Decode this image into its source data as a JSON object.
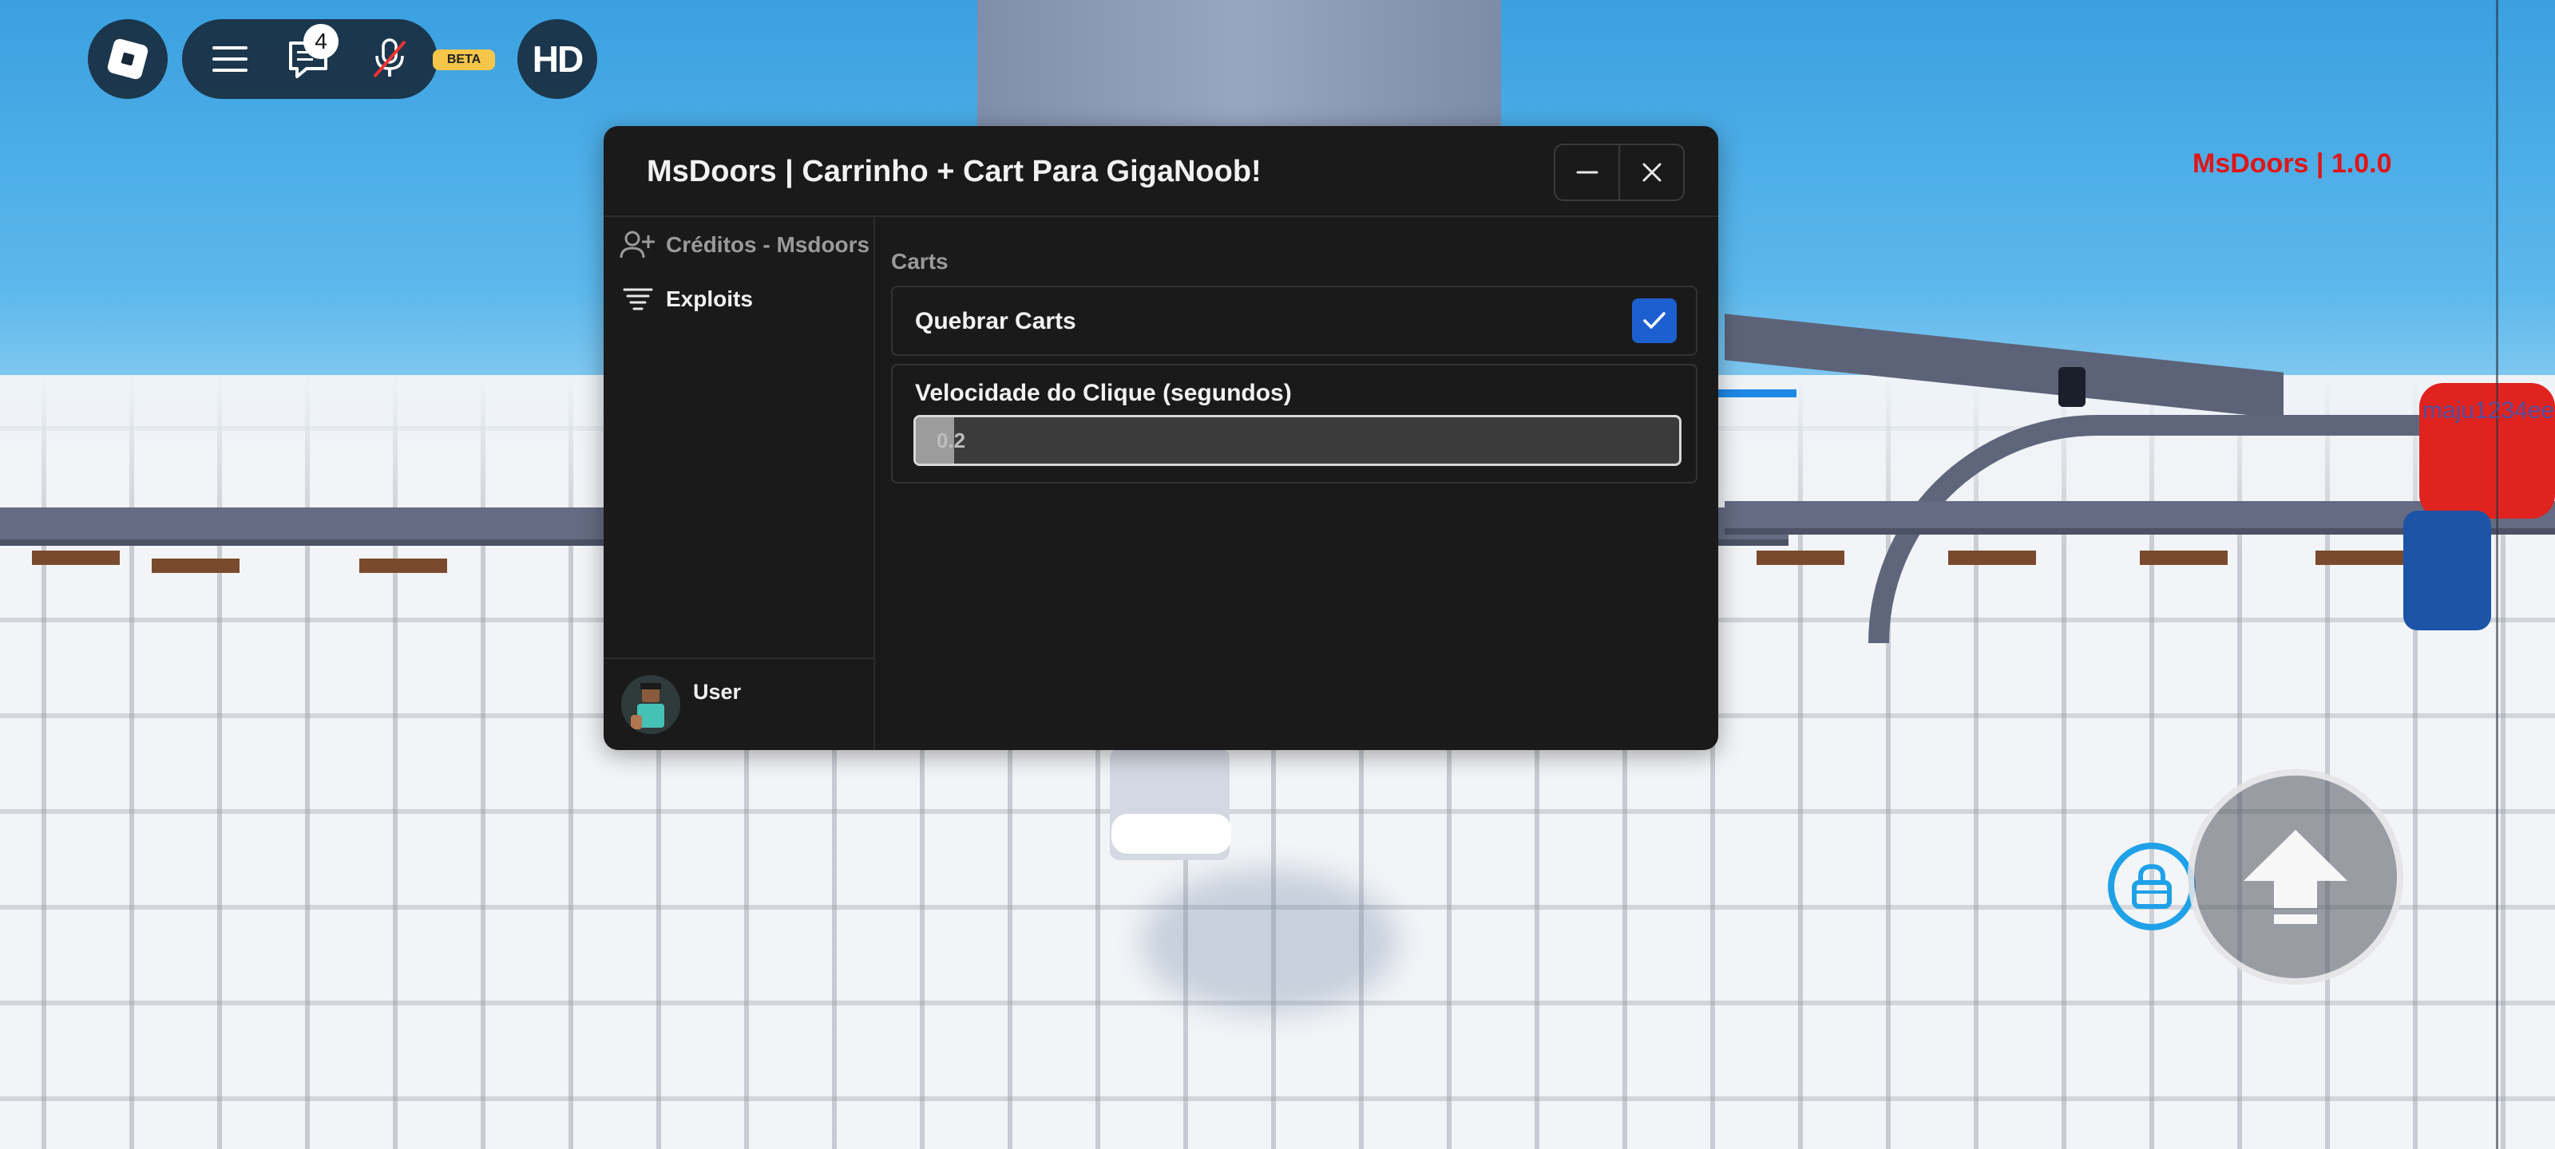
{
  "roblox_bar": {
    "notification_count": "4",
    "beta_label": "BETA",
    "hd_label": "HD",
    "icons": [
      "roblox-logo-icon",
      "menu-icon",
      "chat-icon",
      "mic-muted-icon"
    ]
  },
  "overlay": {
    "version_label": "MsDoors | 1.0.0",
    "player_tag": "maju1234ee"
  },
  "window": {
    "title": "MsDoors | Carrinho + Cart Para GigaNoob!",
    "minimize_icon": "minus-icon",
    "close_icon": "close-icon",
    "sidebar": {
      "items": [
        {
          "label": "Créditos - Msdoors",
          "icon": "user-plus-icon",
          "active": false
        },
        {
          "label": "Exploits",
          "icon": "filter-list-icon",
          "active": true
        }
      ],
      "user": {
        "name": "User"
      }
    },
    "content": {
      "section_title": "Carts",
      "toggle": {
        "label": "Quebrar Carts",
        "checked": true
      },
      "slider": {
        "label": "Velocidade do Clique (segundos)",
        "value": "0.2",
        "fill_fraction": 0.05
      }
    }
  },
  "colors": {
    "accent": "#1c5fd0",
    "window_bg": "#1a1a1a",
    "version_red": "#e01515",
    "lock_blue": "#1fa1e8"
  }
}
